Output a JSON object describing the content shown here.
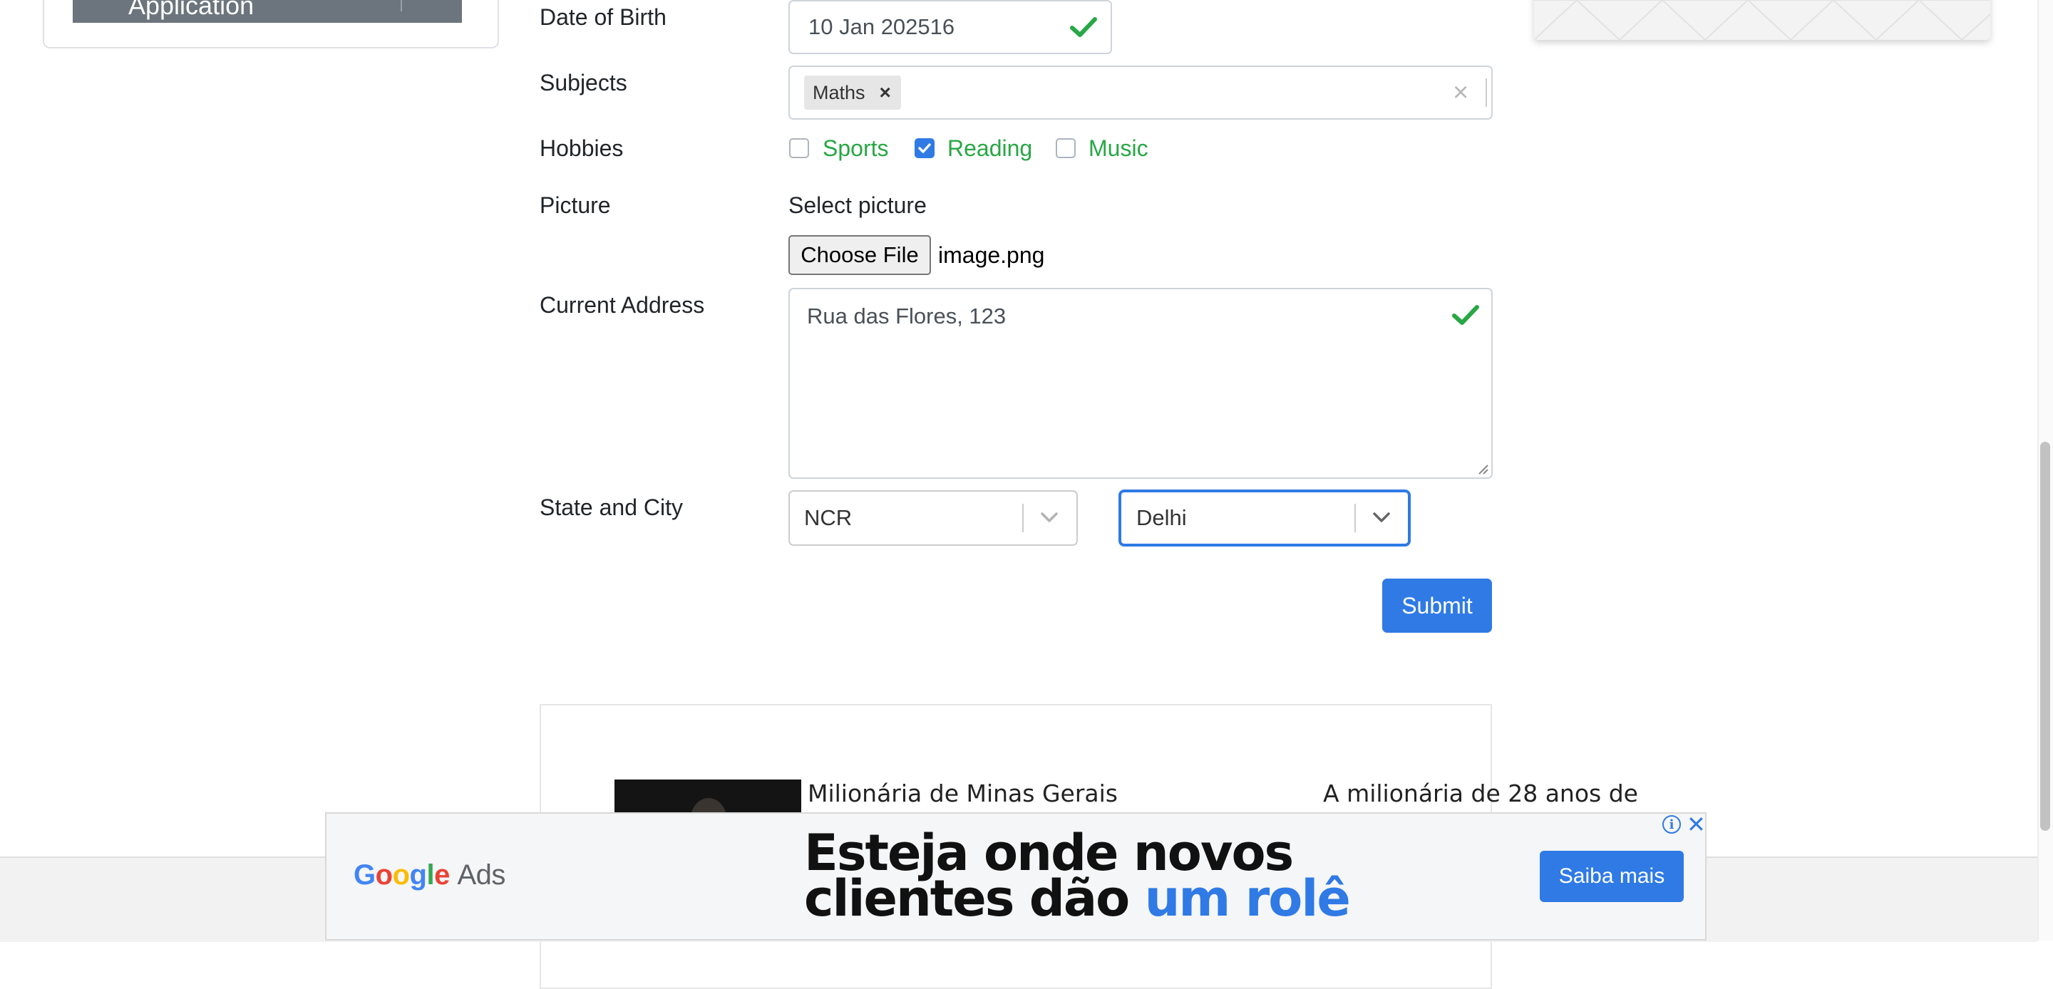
{
  "sidebar": {
    "active_item_label": "Application"
  },
  "form": {
    "dob": {
      "label": "Date of Birth",
      "value": "10 Jan 202516"
    },
    "subjects": {
      "label": "Subjects",
      "chips": [
        "Maths"
      ],
      "chip_remove": "×",
      "clear": "×"
    },
    "hobbies": {
      "label": "Hobbies",
      "options": [
        {
          "label": "Sports",
          "checked": false
        },
        {
          "label": "Reading",
          "checked": true
        },
        {
          "label": "Music",
          "checked": false
        }
      ]
    },
    "picture": {
      "label": "Picture",
      "helper": "Select picture",
      "button": "Choose File",
      "file_name": "image.png"
    },
    "address": {
      "label": "Current Address",
      "value": "Rua das Flores, 123"
    },
    "state_city": {
      "label": "State and City",
      "state": "NCR",
      "city": "Delhi"
    },
    "submit_label": "Submit"
  },
  "ad_content": {
    "article_1": "Milionária de Minas Gerais",
    "article_2": "A milionária de 28 anos de"
  },
  "google_ads": {
    "logo_word_1": "Google",
    "logo_word_2": "Ads",
    "headline_line_1": "Esteja onde novos",
    "headline_line_2_a": "clientes dão",
    "headline_line_2_b": "um rolê",
    "cta": "Saiba mais",
    "info": "i",
    "close": "✕"
  },
  "colors": {
    "primary": "#2f7ae5",
    "success": "#28a745",
    "google_blue": "#4285F4",
    "google_red": "#EA4335",
    "google_yellow": "#FBBC05",
    "google_green": "#34A853"
  }
}
